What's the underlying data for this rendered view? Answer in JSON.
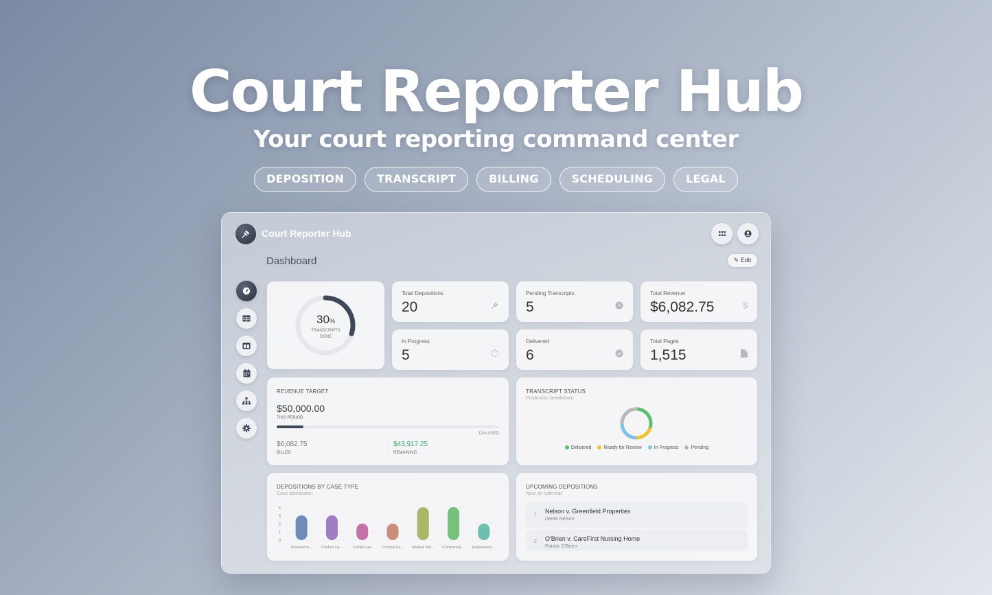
{
  "hero": {
    "title": "Court Reporter Hub",
    "subtitle": "Your court reporting command center",
    "tags": [
      "DEPOSITION",
      "TRANSCRIPT",
      "BILLING",
      "SCHEDULING",
      "LEGAL"
    ]
  },
  "app": {
    "brand": "Court Reporter Hub",
    "page_title": "Dashboard",
    "edit_label": "Edit",
    "icons": {
      "logo": "gavel-icon",
      "apps": "grid-icon",
      "account": "user-circle-icon"
    },
    "nav": [
      {
        "name": "dashboard",
        "icon": "gauge-icon",
        "active": true
      },
      {
        "name": "table",
        "icon": "table-icon",
        "active": false
      },
      {
        "name": "layout",
        "icon": "columns-icon",
        "active": false
      },
      {
        "name": "calendar",
        "icon": "calendar-icon",
        "active": false
      },
      {
        "name": "hierarchy",
        "icon": "sitemap-icon",
        "active": false
      },
      {
        "name": "settings",
        "icon": "gear-icon",
        "active": false
      }
    ]
  },
  "progress": {
    "percent": "30",
    "unit": "%",
    "label_line1": "TRANSCRIPTS",
    "label_line2": "DONE",
    "value": 0.3
  },
  "stats": [
    {
      "label": "Total Depositions",
      "value": "20",
      "icon": "gavel-icon"
    },
    {
      "label": "Pending Transcripts",
      "value": "5",
      "icon": "clock-icon"
    },
    {
      "label": "Total Revenue",
      "value": "$6,082.75",
      "icon": "dollar-icon"
    },
    {
      "label": "In Progress",
      "value": "5",
      "icon": "spinner-icon"
    },
    {
      "label": "Delivered",
      "value": "6",
      "icon": "check-circle-icon"
    },
    {
      "label": "Total Pages",
      "value": "1,515",
      "icon": "file-icon"
    }
  ],
  "revenue": {
    "title": "REVENUE TARGET",
    "target": "$50,000.00",
    "period": "THIS PERIOD",
    "used": "12% USED",
    "used_fraction": 0.12,
    "billed": "$6,082.75",
    "billed_label": "BILLED",
    "remaining": "$43,917.25",
    "remaining_label": "REMAINING"
  },
  "status": {
    "title": "TRANSCRIPT STATUS",
    "subtitle": "Production breakdown",
    "legend": [
      {
        "label": "Delivered",
        "color": "#5bbf6e"
      },
      {
        "label": "Ready for Review",
        "color": "#f2c12e"
      },
      {
        "label": "In Progress",
        "color": "#7cc3ea"
      },
      {
        "label": "Pending",
        "color": "#b8b8b8"
      }
    ],
    "chart_data": {
      "type": "pie",
      "categories": [
        "Delivered",
        "Ready for Review",
        "In Progress",
        "Pending"
      ],
      "values": [
        6,
        4,
        5,
        5
      ]
    }
  },
  "casetype": {
    "title": "DEPOSITIONS BY CASE TYPE",
    "subtitle": "Case distribution",
    "chart_data": {
      "type": "bar",
      "categories": [
        "Personal In...",
        "Product Lia...",
        "Family Law",
        "Criminal De...",
        "Medical Mal...",
        "Commercial ...",
        "Employment ..."
      ],
      "values": [
        3,
        3,
        2,
        2,
        4,
        4,
        2
      ],
      "colors": [
        "#6d8db8",
        "#a07cc5",
        "#c472a6",
        "#c98f7e",
        "#a8b868",
        "#78c07e",
        "#6dbfb0"
      ],
      "yticks": [
        "0",
        "1",
        "2",
        "3",
        "4"
      ],
      "ylim": [
        0,
        4
      ]
    }
  },
  "upcoming": {
    "title": "UPCOMING DEPOSITIONS",
    "subtitle": "Next on calendar",
    "items": [
      {
        "num": "1",
        "title": "Nelson v. Greenfield Properties",
        "person": "Derek Nelson"
      },
      {
        "num": "2",
        "title": "O'Brien v. CareFirst Nursing Home",
        "person": "Patrick O'Brien"
      }
    ]
  }
}
